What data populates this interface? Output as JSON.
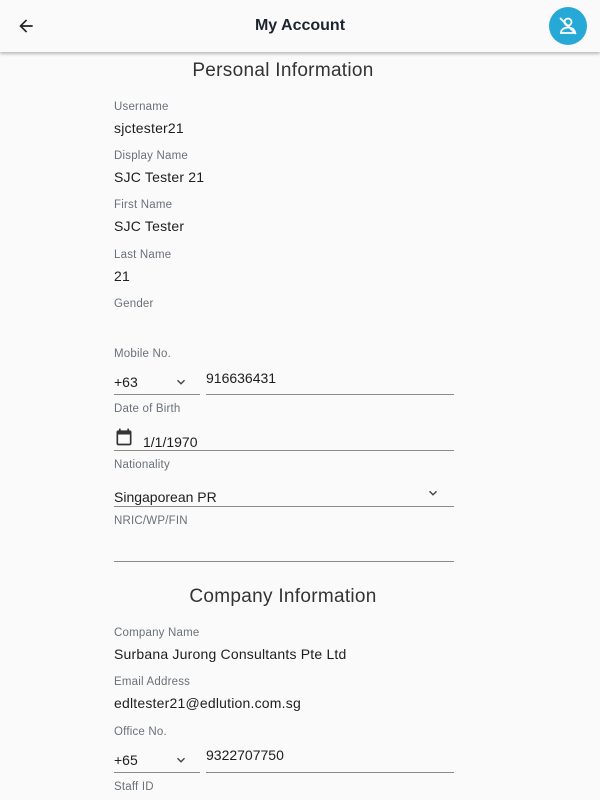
{
  "appbar": {
    "title": "My Account",
    "back_icon": "arrow-left-icon",
    "avatar_icon": "no-user-icon",
    "avatar_color": "#26a9d6"
  },
  "personal": {
    "title": "Personal Information",
    "username": {
      "label": "Username",
      "value": "sjctester21"
    },
    "display_name": {
      "label": "Display Name",
      "value": "SJC Tester 21"
    },
    "first_name": {
      "label": "First Name",
      "value": "SJC Tester"
    },
    "last_name": {
      "label": "Last Name",
      "value": "21"
    },
    "gender": {
      "label": "Gender",
      "value": ""
    },
    "mobile": {
      "label": "Mobile No.",
      "country_code": "+63",
      "number": "916636431"
    },
    "dob": {
      "label": "Date of Birth",
      "value": "1/1/1970",
      "icon": "calendar-icon"
    },
    "nationality": {
      "label": "Nationality",
      "value": "Singaporean PR"
    },
    "nric": {
      "label": "NRIC/WP/FIN",
      "value": ""
    }
  },
  "company": {
    "title": "Company Information",
    "company_name": {
      "label": "Company Name",
      "value": "Surbana Jurong Consultants Pte Ltd"
    },
    "email": {
      "label": "Email Address",
      "value": "edltester21@edlution.com.sg"
    },
    "office": {
      "label": "Office No.",
      "country_code": "+65",
      "number": "9322707750"
    },
    "staff_id": {
      "label": "Staff ID"
    }
  }
}
